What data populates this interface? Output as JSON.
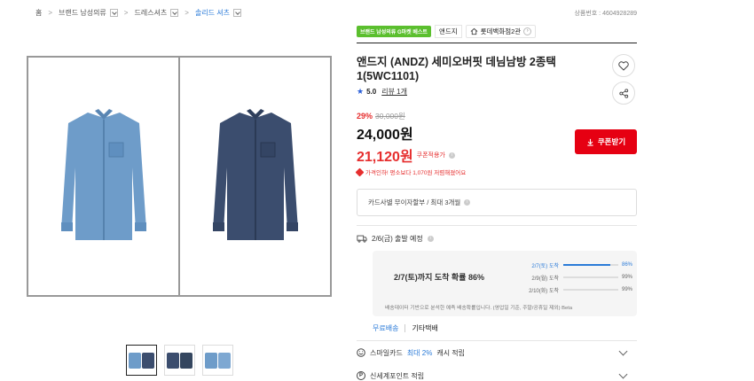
{
  "breadcrumb": [
    {
      "label": "홈",
      "dropdown": false
    },
    {
      "label": "브랜드 남성의류",
      "dropdown": true
    },
    {
      "label": "드레스셔츠",
      "dropdown": true
    },
    {
      "label": "솔리드 셔츠",
      "dropdown": true
    }
  ],
  "product_no": "상품번호 : 4604928289",
  "badges": {
    "best": "브랜드 남성의류 G마켓 베스트",
    "brand": "앤드지",
    "store": "롯데백화점2관"
  },
  "product": {
    "title": "앤드지 (ANDZ) 세미오버핏 데님남방 2종택1(5WC1101)",
    "rating": "5.0",
    "reviews": "리뷰 1개",
    "discount_rate": "29%",
    "original_price": "30,000원",
    "sale_price": "24,000원",
    "coupon_price": "21,120원",
    "coupon_label": "쿠폰적용가",
    "lowest_note": "가격인하! 평소보다 1,070원 저렴해졌어요",
    "coupon_button": "쿠폰받기"
  },
  "card_info": "카드사별 무이자할부 / 최대 3개월",
  "shipping": {
    "eta": "2/6(금) 출발 예정",
    "probability": "2/7(토)까지 도착 확률 86%",
    "rows": [
      {
        "label": "2/7(토) 도착",
        "pct": "86%",
        "value": 0.86,
        "highlight": true
      },
      {
        "label": "2/9(월) 도착",
        "pct": "99%",
        "value": 0.99,
        "highlight": false
      },
      {
        "label": "2/10(화) 도착",
        "pct": "99%",
        "value": 0.99,
        "highlight": false
      }
    ],
    "note": "배송데이터 기반으로 분석한 예측 배송확률입니다. (영업일 기준, 주말/공휴일 제외)  Beta",
    "free": "무료배송",
    "carrier": "기타택배"
  },
  "smilecard": {
    "prefix": "스마일카드",
    "highlight": "최대 2%",
    "suffix": "캐시 적립"
  },
  "shinsegae": "신세계포인트 적립",
  "colors": {
    "accent_red": "#e62e2e",
    "button_red": "#e60012",
    "blue": "#2b7bd8",
    "badge_green": "#5bbf2e"
  },
  "icons": [
    "heart-icon",
    "share-icon",
    "star-icon",
    "truck-icon",
    "download-icon",
    "smile-icon",
    "point-icon",
    "chevron-down-icon",
    "home-store-icon"
  ]
}
